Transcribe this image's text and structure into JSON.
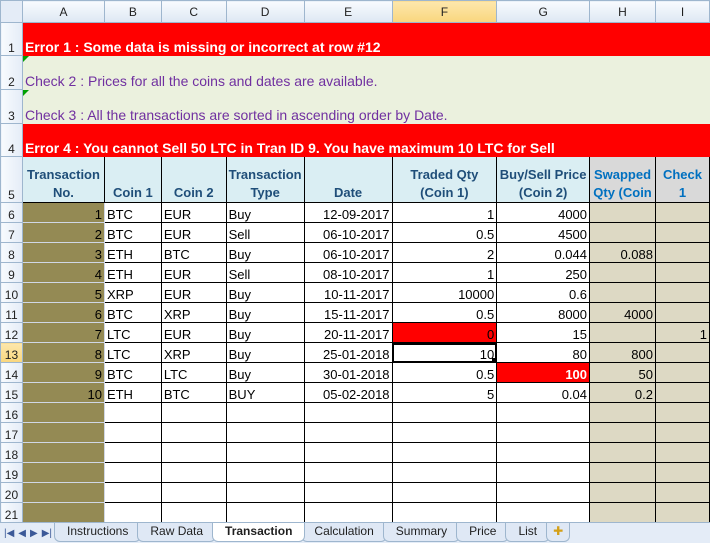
{
  "columns": [
    "A",
    "B",
    "C",
    "D",
    "E",
    "F",
    "G",
    "H",
    "I"
  ],
  "selected_column": "F",
  "selected_row": "13",
  "messages": {
    "error1": "Error 1 : Some data is missing or incorrect at row #12",
    "check2": "Check 2 : Prices for all the coins and dates are available.",
    "check3": "Check 3 : All the transactions are sorted in ascending order by Date.",
    "error4": "Error 4 : You cannot Sell 50 LTC in Tran ID 9. You have maximum 10 LTC for Sell"
  },
  "header_row": {
    "txn_no": "Transaction No.",
    "coin1": "Coin 1",
    "coin2": "Coin 2",
    "txn_type": "Transaction Type",
    "date": "Date",
    "traded_qty": "Traded Qty (Coin 1)",
    "price": "Buy/Sell Price (Coin 2)",
    "swapped": "Swapped Qty (Coin",
    "check1": "Check 1"
  },
  "row_numbers": [
    "1",
    "2",
    "3",
    "4",
    "5",
    "6",
    "7",
    "8",
    "9",
    "10",
    "11",
    "12",
    "13",
    "14",
    "15",
    "16",
    "17",
    "18",
    "19",
    "20",
    "21"
  ],
  "transactions": [
    {
      "id": "1",
      "coin1": "BTC",
      "coin2": "EUR",
      "type": "Buy",
      "date": "12-09-2017",
      "qty": "1",
      "price": "4000",
      "swapped": "",
      "check": ""
    },
    {
      "id": "2",
      "coin1": "BTC",
      "coin2": "EUR",
      "type": "Sell",
      "date": "06-10-2017",
      "qty": "0.5",
      "price": "4500",
      "swapped": "",
      "check": ""
    },
    {
      "id": "3",
      "coin1": "ETH",
      "coin2": "BTC",
      "type": "Buy",
      "date": "06-10-2017",
      "qty": "2",
      "price": "0.044",
      "swapped": "0.088",
      "check": ""
    },
    {
      "id": "4",
      "coin1": "ETH",
      "coin2": "EUR",
      "type": "Sell",
      "date": "08-10-2017",
      "qty": "1",
      "price": "250",
      "swapped": "",
      "check": ""
    },
    {
      "id": "5",
      "coin1": "XRP",
      "coin2": "EUR",
      "type": "Buy",
      "date": "10-11-2017",
      "qty": "10000",
      "price": "0.6",
      "swapped": "",
      "check": ""
    },
    {
      "id": "6",
      "coin1": "BTC",
      "coin2": "XRP",
      "type": "Buy",
      "date": "15-11-2017",
      "qty": "0.5",
      "price": "8000",
      "swapped": "4000",
      "check": ""
    },
    {
      "id": "7",
      "coin1": "LTC",
      "coin2": "EUR",
      "type": "Buy",
      "date": "20-11-2017",
      "qty": "0",
      "price": "15",
      "swapped": "",
      "check": "1"
    },
    {
      "id": "8",
      "coin1": "LTC",
      "coin2": "XRP",
      "type": "Buy",
      "date": "25-01-2018",
      "qty": "10",
      "price": "80",
      "swapped": "800",
      "check": ""
    },
    {
      "id": "9",
      "coin1": "BTC",
      "coin2": "LTC",
      "type": "Buy",
      "date": "30-01-2018",
      "qty": "0.5",
      "price": "100",
      "swapped": "50",
      "check": ""
    },
    {
      "id": "10",
      "coin1": "ETH",
      "coin2": "BTC",
      "type": "BUY",
      "date": "05-02-2018",
      "qty": "5",
      "price": "0.04",
      "swapped": "0.2",
      "check": ""
    }
  ],
  "tabs": [
    "Instructions",
    "Raw Data",
    "Transaction",
    "Calculation",
    "Summary",
    "Price",
    "List"
  ],
  "active_tab": "Transaction",
  "colors": {
    "error": "#ff0000",
    "check": "#7030a0",
    "txn_col": "#948a54",
    "swapped_col": "#ddd9c4",
    "header": "#daeef3"
  }
}
